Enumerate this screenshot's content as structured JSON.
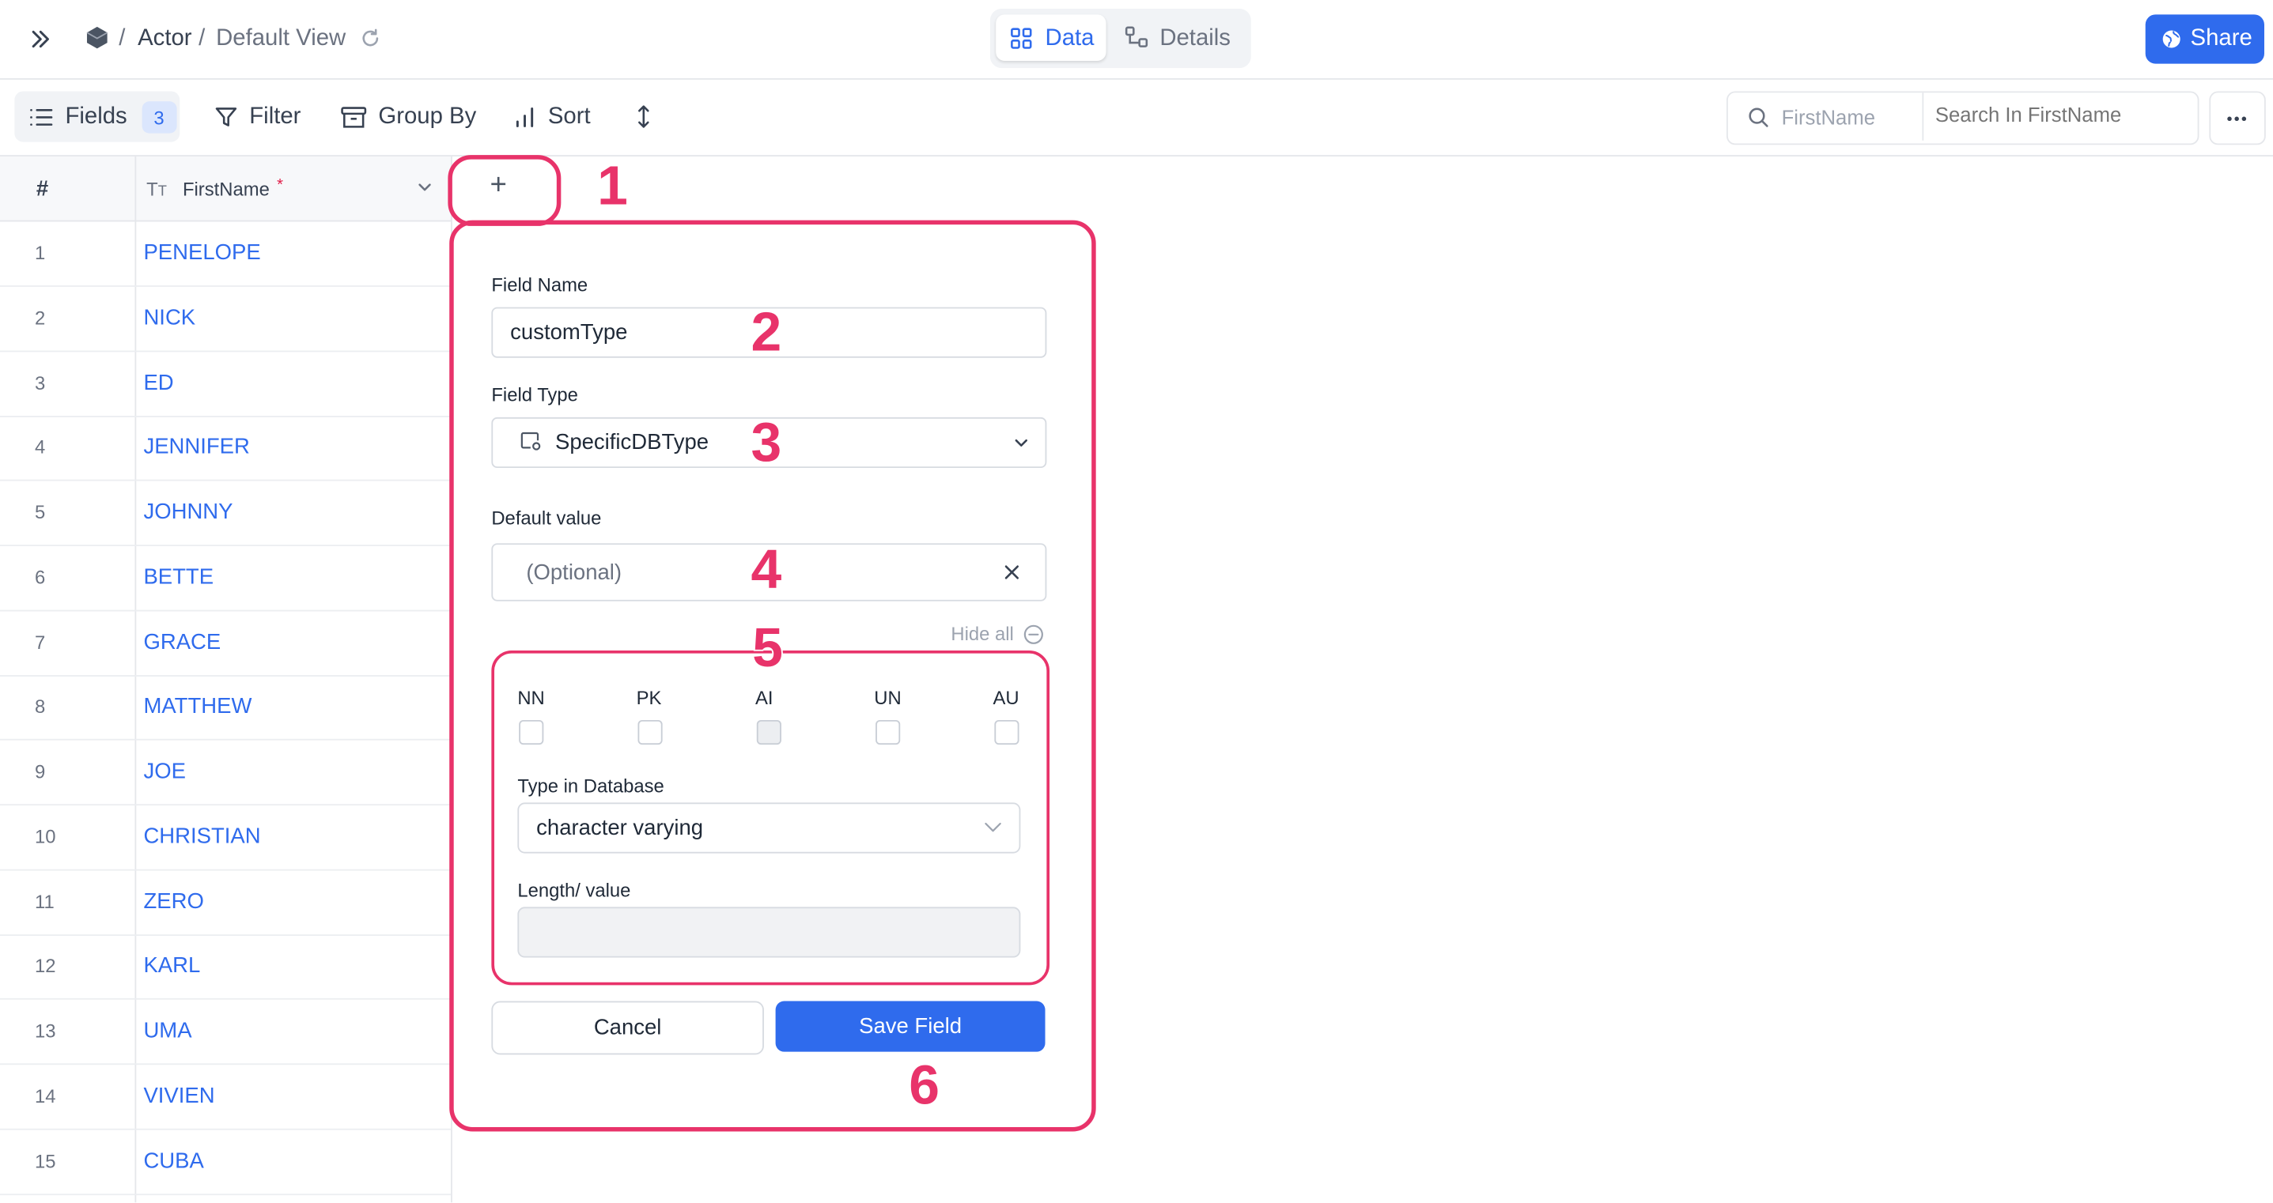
{
  "breadcrumb": {
    "table": "Actor",
    "view": "Default View",
    "sep1": "/",
    "sep2": "/"
  },
  "view_tabs": {
    "data": "Data",
    "details": "Details"
  },
  "share_label": "Share",
  "toolbar": {
    "fields_label": "Fields",
    "fields_count": "3",
    "filter_label": "Filter",
    "group_by_label": "Group By",
    "sort_label": "Sort"
  },
  "search": {
    "field": "FirstName",
    "placeholder": "Search In FirstName"
  },
  "grid": {
    "index_header": "#",
    "column_header": "FirstName",
    "required_mark": "*",
    "add_column": "+",
    "rows": [
      {
        "n": "1",
        "name": "PENELOPE"
      },
      {
        "n": "2",
        "name": "NICK"
      },
      {
        "n": "3",
        "name": "ED"
      },
      {
        "n": "4",
        "name": "JENNIFER"
      },
      {
        "n": "5",
        "name": "JOHNNY"
      },
      {
        "n": "6",
        "name": "BETTE"
      },
      {
        "n": "7",
        "name": "GRACE"
      },
      {
        "n": "8",
        "name": "MATTHEW"
      },
      {
        "n": "9",
        "name": "JOE"
      },
      {
        "n": "10",
        "name": "CHRISTIAN"
      },
      {
        "n": "11",
        "name": "ZERO"
      },
      {
        "n": "12",
        "name": "KARL"
      },
      {
        "n": "13",
        "name": "UMA"
      },
      {
        "n": "14",
        "name": "VIVIEN"
      },
      {
        "n": "15",
        "name": "CUBA"
      }
    ]
  },
  "form": {
    "field_name_label": "Field Name",
    "field_name_value": "customType",
    "field_type_label": "Field Type",
    "field_type_value": "SpecificDBType",
    "default_label": "Default value",
    "default_placeholder": "(Optional)",
    "hide_all": "Hide all",
    "flags": [
      "NN",
      "PK",
      "AI",
      "UN",
      "AU"
    ],
    "type_in_db_label": "Type in Database",
    "type_in_db_value": "character varying",
    "length_label": "Length/ value",
    "cancel": "Cancel",
    "save": "Save Field"
  },
  "annotations": [
    "1",
    "2",
    "3",
    "4",
    "5",
    "6"
  ],
  "colors": {
    "accent": "#2f6bed",
    "annotation": "#e8336a"
  }
}
